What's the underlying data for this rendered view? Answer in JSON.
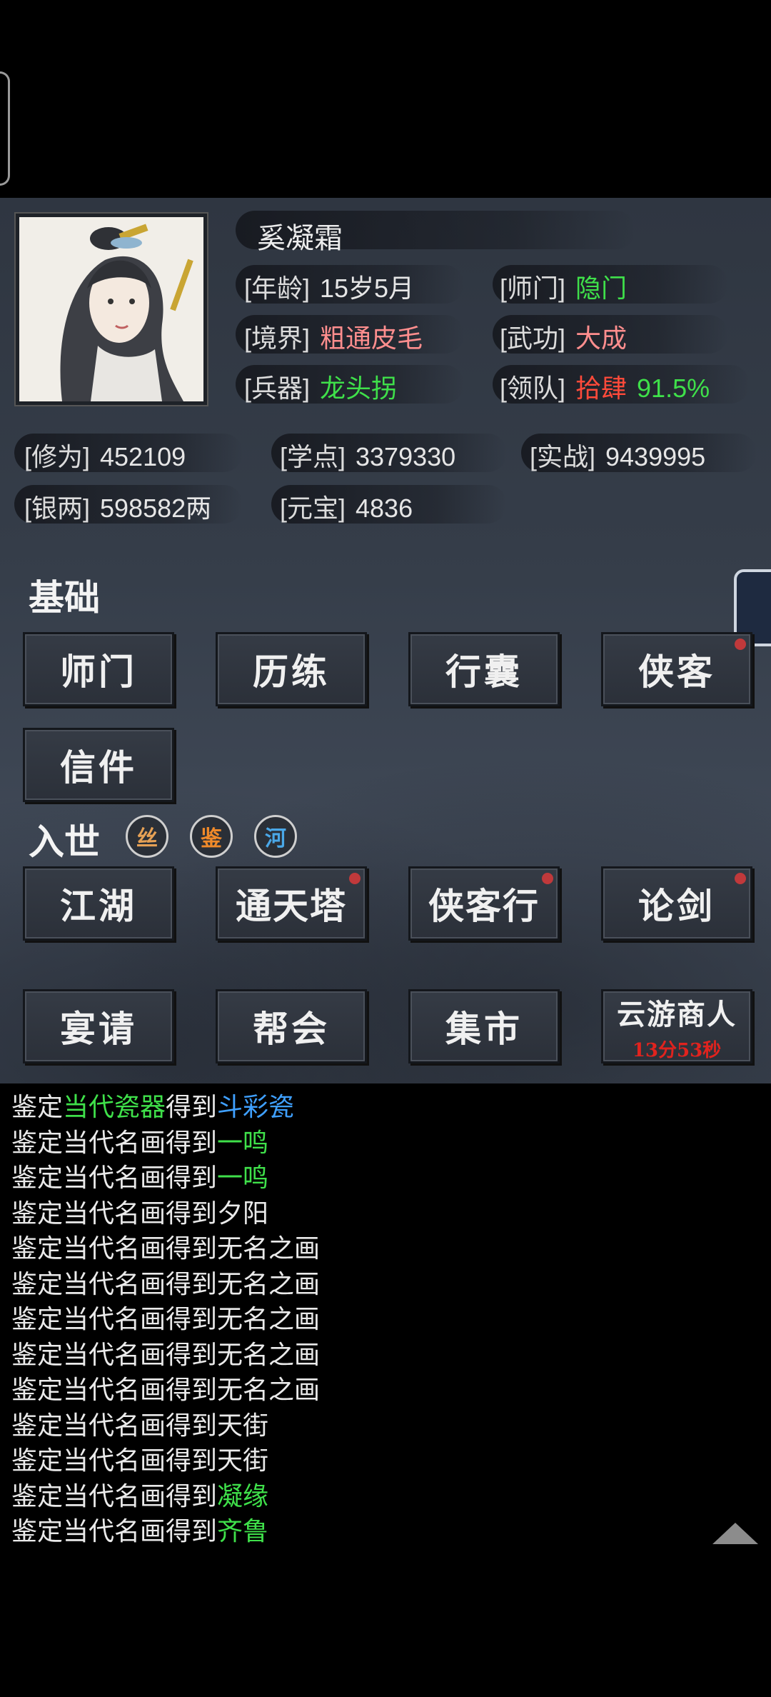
{
  "character": {
    "name": "奚凝霜",
    "stats_top": [
      {
        "label": "[年龄]",
        "value": "15岁5月"
      },
      {
        "label": "[师门]",
        "value": "隐门"
      },
      {
        "label": "[境界]",
        "value": "粗通皮毛"
      },
      {
        "label": "[武功]",
        "value": "大成"
      },
      {
        "label": "[兵器]",
        "value": "龙头拐"
      },
      {
        "label": "[领队]",
        "value": "拾肆",
        "extra": "91.5%"
      }
    ],
    "stats_bottom": [
      {
        "label": "[修为]",
        "value": "452109"
      },
      {
        "label": "[学点]",
        "value": "3379330"
      },
      {
        "label": "[实战]",
        "value": "9439995"
      },
      {
        "label": "[银两]",
        "value": "598582两"
      },
      {
        "label": "[元宝]",
        "value": "4836"
      }
    ]
  },
  "sections": {
    "basic_title": "基础",
    "world_title": "入世",
    "seals": [
      "丝",
      "鉴",
      "河"
    ],
    "basic_buttons": [
      "师门",
      "历练",
      "行囊",
      "侠客",
      "信件"
    ],
    "world_buttons": [
      "江湖",
      "通天塔",
      "侠客行",
      "论剑",
      "宴请",
      "帮会",
      "集市",
      "云游商人"
    ],
    "merchant_timer": "13分53秒"
  },
  "log": [
    {
      "prefix": "鉴定",
      "mid": "当代瓷器",
      "mid_color": "#3fe04a",
      "join": "得到",
      "item": "斗彩瓷",
      "item_color": "#3fa0ff"
    },
    {
      "prefix": "鉴定当代名画",
      "mid": "",
      "join": "得到",
      "item": "一鸣",
      "item_color": "#3fe04a"
    },
    {
      "prefix": "鉴定当代名画",
      "mid": "",
      "join": "得到",
      "item": "一鸣",
      "item_color": "#3fe04a"
    },
    {
      "prefix": "鉴定当代名画",
      "mid": "",
      "join": "得到",
      "item": "夕阳",
      "item_color": "#eaeaea"
    },
    {
      "prefix": "鉴定当代名画",
      "mid": "",
      "join": "得到",
      "item": "无名之画",
      "item_color": "#eaeaea"
    },
    {
      "prefix": "鉴定当代名画",
      "mid": "",
      "join": "得到",
      "item": "无名之画",
      "item_color": "#eaeaea"
    },
    {
      "prefix": "鉴定当代名画",
      "mid": "",
      "join": "得到",
      "item": "无名之画",
      "item_color": "#eaeaea"
    },
    {
      "prefix": "鉴定当代名画",
      "mid": "",
      "join": "得到",
      "item": "无名之画",
      "item_color": "#eaeaea"
    },
    {
      "prefix": "鉴定当代名画",
      "mid": "",
      "join": "得到",
      "item": "无名之画",
      "item_color": "#eaeaea"
    },
    {
      "prefix": "鉴定当代名画",
      "mid": "",
      "join": "得到",
      "item": "天街",
      "item_color": "#eaeaea"
    },
    {
      "prefix": "鉴定当代名画",
      "mid": "",
      "join": "得到",
      "item": "天街",
      "item_color": "#eaeaea"
    },
    {
      "prefix": "鉴定当代名画",
      "mid": "",
      "join": "得到",
      "item": "凝缘",
      "item_color": "#3fe04a"
    },
    {
      "prefix": "鉴定当代名画",
      "mid": "",
      "join": "得到",
      "item": "齐鲁",
      "item_color": "#3fe04a"
    }
  ]
}
